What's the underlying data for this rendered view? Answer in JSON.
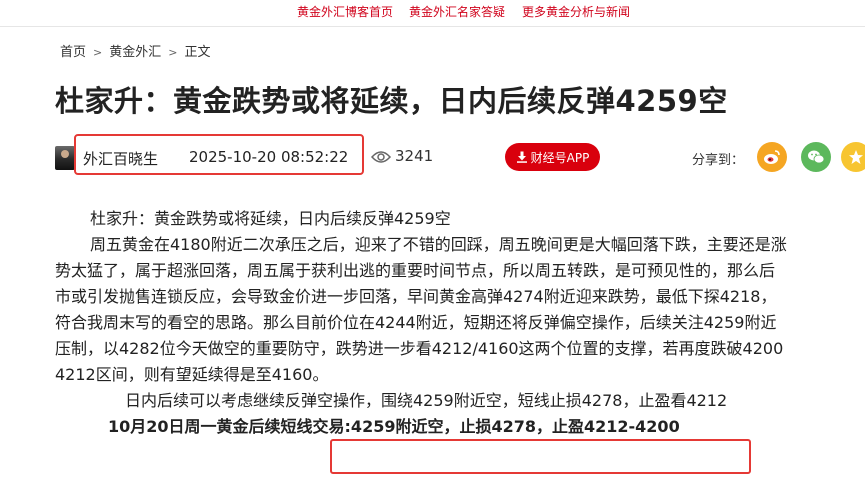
{
  "top_nav": {
    "links": [
      "黄金外汇博客首页",
      "黄金外汇名家答疑",
      "更多黄金分析与新闻"
    ]
  },
  "breadcrumb": {
    "items": [
      "首页",
      "黄金外汇",
      "正文"
    ],
    "separator": ">"
  },
  "article": {
    "title": "杜家升：黄金跌势或将延续，日内后续反弹4259空",
    "author": "外汇百晓生",
    "published": "2025-10-20 08:52:22",
    "views": "3241",
    "app_button": "财经号APP",
    "share_label": "分享到：",
    "share_icons": [
      "weibo-icon",
      "wechat-icon",
      "qzone-icon"
    ],
    "lines": [
      "杜家升：黄金跌势或将延续，日内后续反弹4259空",
      "周五黄金在4180附近二次承压之后，迎来了不错的回踩，周五晚间更是大幅回落下跌，主要还是涨",
      "势太猛了，属于超涨回落，周五属于获利出逃的重要时间节点，所以周五转跌，是可预见性的，那么后",
      "市或引发抛售连锁反应，会导致金价进一步回落，早间黄金高弹4274附近迎来跌势，最低下探4218，",
      "符合我周末写的看空的思路。那么目前价位在4244附近，短期还将反弹偏空操作，后续关注4259附近",
      "压制，以4282位今天做空的重要防守，跌势进一步看4212/4160这两个位置的支撑，若再度跌破4200",
      "4212区间，则有望延续得是至4160。"
    ],
    "strategy": "日内后续可以考虑继续反弹空操作，围绕4259附近空，短线止损4278，止盈看4212",
    "final_line": "10月20日周一黄金后续短线交易:4259附近空，止损4278，止盈4212-4200"
  },
  "colors": {
    "accent_red": "#d9000d",
    "nav_red": "#d0021b",
    "highlight_border": "#e53935",
    "weibo": "#f5a623",
    "wechat": "#5cb85c",
    "qzone": "#f7c531"
  }
}
